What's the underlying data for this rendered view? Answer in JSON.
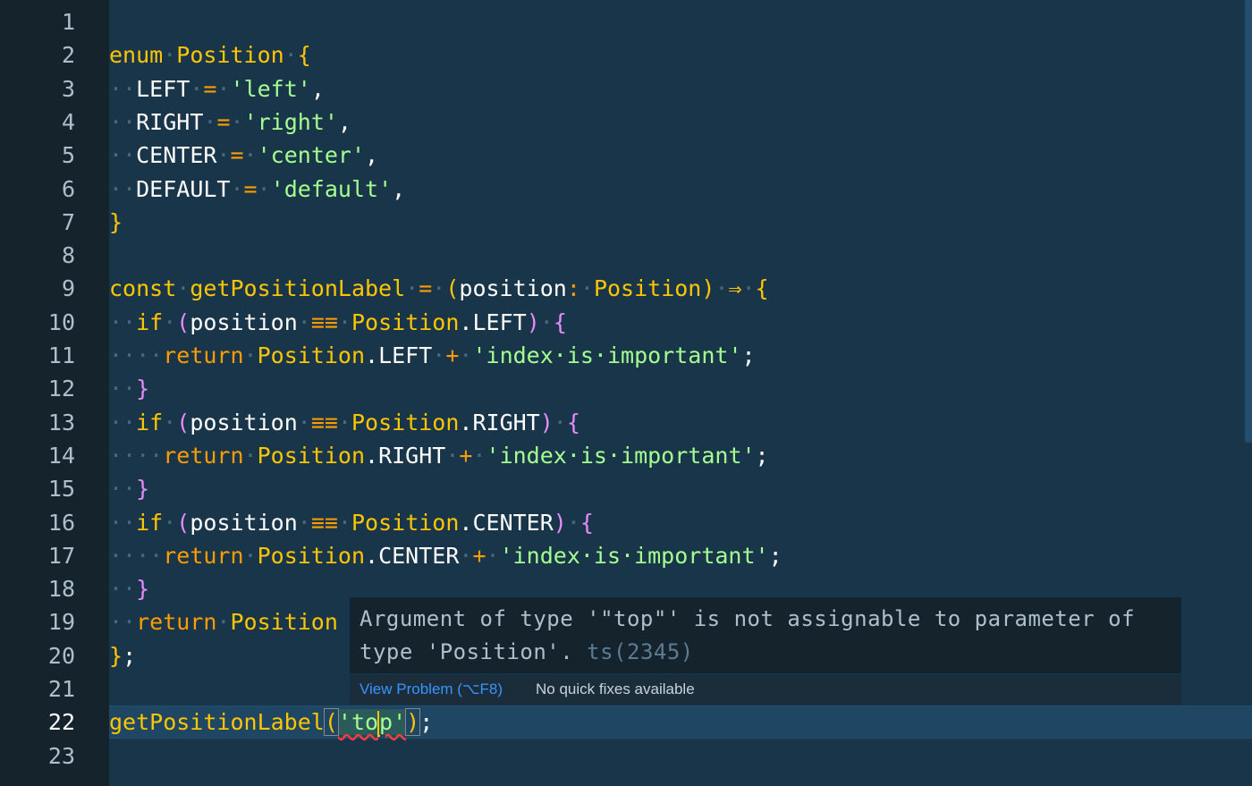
{
  "editor": {
    "language": "typescript",
    "line_numbers": [
      "1",
      "2",
      "3",
      "4",
      "5",
      "6",
      "7",
      "8",
      "9",
      "10",
      "11",
      "12",
      "13",
      "14",
      "15",
      "16",
      "17",
      "18",
      "19",
      "20",
      "21",
      "22",
      "23"
    ],
    "active_line": "22",
    "lines": [
      [],
      [
        {
          "t": "enum",
          "c": "kw"
        },
        {
          "t": "·",
          "c": "ws"
        },
        {
          "t": "Position",
          "c": "id"
        },
        {
          "t": "·",
          "c": "ws"
        },
        {
          "t": "{",
          "c": "brace"
        }
      ],
      [
        {
          "t": "··",
          "c": "ws"
        },
        {
          "t": "LEFT",
          "c": "plain"
        },
        {
          "t": "·",
          "c": "ws"
        },
        {
          "t": "=",
          "c": "op"
        },
        {
          "t": "·",
          "c": "ws"
        },
        {
          "t": "'left'",
          "c": "str"
        },
        {
          "t": ",",
          "c": "plain"
        }
      ],
      [
        {
          "t": "··",
          "c": "ws"
        },
        {
          "t": "RIGHT",
          "c": "plain"
        },
        {
          "t": "·",
          "c": "ws"
        },
        {
          "t": "=",
          "c": "op"
        },
        {
          "t": "·",
          "c": "ws"
        },
        {
          "t": "'right'",
          "c": "str"
        },
        {
          "t": ",",
          "c": "plain"
        }
      ],
      [
        {
          "t": "··",
          "c": "ws"
        },
        {
          "t": "CENTER",
          "c": "plain"
        },
        {
          "t": "·",
          "c": "ws"
        },
        {
          "t": "=",
          "c": "op"
        },
        {
          "t": "·",
          "c": "ws"
        },
        {
          "t": "'center'",
          "c": "str"
        },
        {
          "t": ",",
          "c": "plain"
        }
      ],
      [
        {
          "t": "··",
          "c": "ws"
        },
        {
          "t": "DEFAULT",
          "c": "plain"
        },
        {
          "t": "·",
          "c": "ws"
        },
        {
          "t": "=",
          "c": "op"
        },
        {
          "t": "·",
          "c": "ws"
        },
        {
          "t": "'default'",
          "c": "str"
        },
        {
          "t": ",",
          "c": "plain"
        }
      ],
      [
        {
          "t": "}",
          "c": "brace"
        }
      ],
      [],
      [
        {
          "t": "const",
          "c": "kw"
        },
        {
          "t": "·",
          "c": "ws"
        },
        {
          "t": "getPositionLabel",
          "c": "id"
        },
        {
          "t": "·",
          "c": "ws"
        },
        {
          "t": "=",
          "c": "op"
        },
        {
          "t": "·",
          "c": "ws"
        },
        {
          "t": "(",
          "c": "brace"
        },
        {
          "t": "position",
          "c": "plain"
        },
        {
          "t": ":",
          "c": "op"
        },
        {
          "t": "·",
          "c": "ws"
        },
        {
          "t": "Position",
          "c": "type"
        },
        {
          "t": ")",
          "c": "brace"
        },
        {
          "t": "·",
          "c": "ws"
        },
        {
          "t": "⇒",
          "c": "arrow"
        },
        {
          "t": "·",
          "c": "ws"
        },
        {
          "t": "{",
          "c": "brace"
        }
      ],
      [
        {
          "t": "··",
          "c": "ws"
        },
        {
          "t": "if",
          "c": "kw"
        },
        {
          "t": "·",
          "c": "ws"
        },
        {
          "t": "(",
          "c": "brace3"
        },
        {
          "t": "position",
          "c": "plain"
        },
        {
          "t": "·",
          "c": "ws"
        },
        {
          "t": "≡≡",
          "c": "op"
        },
        {
          "t": "·",
          "c": "ws"
        },
        {
          "t": "Position",
          "c": "id"
        },
        {
          "t": ".LEFT",
          "c": "plain"
        },
        {
          "t": ")",
          "c": "brace3"
        },
        {
          "t": "·",
          "c": "ws"
        },
        {
          "t": "{",
          "c": "brace3"
        }
      ],
      [
        {
          "t": "····",
          "c": "ws"
        },
        {
          "t": "return",
          "c": "op"
        },
        {
          "t": "·",
          "c": "ws"
        },
        {
          "t": "Position",
          "c": "id"
        },
        {
          "t": ".LEFT",
          "c": "plain"
        },
        {
          "t": "·",
          "c": "ws"
        },
        {
          "t": "+",
          "c": "op"
        },
        {
          "t": "·",
          "c": "ws"
        },
        {
          "t": "'index·is·important'",
          "c": "str"
        },
        {
          "t": ";",
          "c": "plain"
        }
      ],
      [
        {
          "t": "··",
          "c": "ws"
        },
        {
          "t": "}",
          "c": "brace3"
        }
      ],
      [
        {
          "t": "··",
          "c": "ws"
        },
        {
          "t": "if",
          "c": "kw"
        },
        {
          "t": "·",
          "c": "ws"
        },
        {
          "t": "(",
          "c": "brace3"
        },
        {
          "t": "position",
          "c": "plain"
        },
        {
          "t": "·",
          "c": "ws"
        },
        {
          "t": "≡≡",
          "c": "op"
        },
        {
          "t": "·",
          "c": "ws"
        },
        {
          "t": "Position",
          "c": "id"
        },
        {
          "t": ".RIGHT",
          "c": "plain"
        },
        {
          "t": ")",
          "c": "brace3"
        },
        {
          "t": "·",
          "c": "ws"
        },
        {
          "t": "{",
          "c": "brace3"
        }
      ],
      [
        {
          "t": "····",
          "c": "ws"
        },
        {
          "t": "return",
          "c": "op"
        },
        {
          "t": "·",
          "c": "ws"
        },
        {
          "t": "Position",
          "c": "id"
        },
        {
          "t": ".RIGHT",
          "c": "plain"
        },
        {
          "t": "·",
          "c": "ws"
        },
        {
          "t": "+",
          "c": "op"
        },
        {
          "t": "·",
          "c": "ws"
        },
        {
          "t": "'index·is·important'",
          "c": "str"
        },
        {
          "t": ";",
          "c": "plain"
        }
      ],
      [
        {
          "t": "··",
          "c": "ws"
        },
        {
          "t": "}",
          "c": "brace3"
        }
      ],
      [
        {
          "t": "··",
          "c": "ws"
        },
        {
          "t": "if",
          "c": "kw"
        },
        {
          "t": "·",
          "c": "ws"
        },
        {
          "t": "(",
          "c": "brace3"
        },
        {
          "t": "position",
          "c": "plain"
        },
        {
          "t": "·",
          "c": "ws"
        },
        {
          "t": "≡≡",
          "c": "op"
        },
        {
          "t": "·",
          "c": "ws"
        },
        {
          "t": "Position",
          "c": "id"
        },
        {
          "t": ".CENTER",
          "c": "plain"
        },
        {
          "t": ")",
          "c": "brace3"
        },
        {
          "t": "·",
          "c": "ws"
        },
        {
          "t": "{",
          "c": "brace3"
        }
      ],
      [
        {
          "t": "····",
          "c": "ws"
        },
        {
          "t": "return",
          "c": "op"
        },
        {
          "t": "·",
          "c": "ws"
        },
        {
          "t": "Position",
          "c": "id"
        },
        {
          "t": ".CENTER",
          "c": "plain"
        },
        {
          "t": "·",
          "c": "ws"
        },
        {
          "t": "+",
          "c": "op"
        },
        {
          "t": "·",
          "c": "ws"
        },
        {
          "t": "'index·is·important'",
          "c": "str"
        },
        {
          "t": ";",
          "c": "plain"
        }
      ],
      [
        {
          "t": "··",
          "c": "ws"
        },
        {
          "t": "}",
          "c": "brace3"
        }
      ],
      [
        {
          "t": "··",
          "c": "ws"
        },
        {
          "t": "return",
          "c": "op"
        },
        {
          "t": "·",
          "c": "ws"
        },
        {
          "t": "Position",
          "c": "id"
        }
      ],
      [
        {
          "t": "}",
          "c": "brace"
        },
        {
          "t": ";",
          "c": "plain"
        }
      ],
      [],
      [
        {
          "t": "getPositionLabel",
          "c": "id"
        },
        {
          "t": "(",
          "c": "bracket"
        },
        {
          "t": "'to",
          "c": "err"
        },
        {
          "t": "",
          "c": "cursor"
        },
        {
          "t": "p'",
          "c": "err"
        },
        {
          "t": ")",
          "c": "bracket"
        },
        {
          "t": ";",
          "c": "plain"
        }
      ],
      []
    ]
  },
  "hover": {
    "message": "Argument of type '\"top\"' is not assignable to parameter of type 'Position'.",
    "code": "ts(2345)",
    "view_problem": "View Problem (⌥F8)",
    "no_fixes": "No quick fixes available"
  },
  "colors": {
    "background": "#193549",
    "gutter": "#15232d",
    "keyword": "#ffc600",
    "string": "#a5ff90",
    "operator": "#ff9d00",
    "brace": "#e78cff",
    "link": "#3794ff"
  }
}
